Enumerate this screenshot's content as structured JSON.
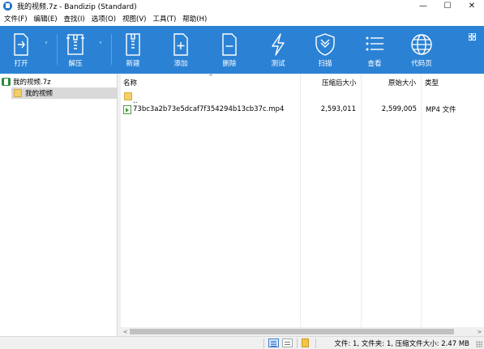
{
  "window": {
    "title": "我的视频.7z - Bandizip (Standard)",
    "minimize_glyph": "—",
    "maximize_glyph": "☐",
    "close_glyph": "✕"
  },
  "menu": [
    {
      "label": "文件(F)"
    },
    {
      "label": "编辑(E)"
    },
    {
      "label": "查找(I)"
    },
    {
      "label": "选项(O)"
    },
    {
      "label": "视图(V)"
    },
    {
      "label": "工具(T)"
    },
    {
      "label": "帮助(H)"
    }
  ],
  "toolbar": {
    "open": "打开",
    "extract": "解压",
    "new": "新建",
    "add": "添加",
    "delete": "删除",
    "test": "测试",
    "scan": "扫描",
    "view": "查看",
    "codepage": "代码页",
    "dropdown_glyph": "˅"
  },
  "tree": {
    "root": "我的视频.7z",
    "child": "我的视频"
  },
  "list": {
    "columns": {
      "name": "名称",
      "packed_size": "压缩后大小",
      "original_size": "原始大小",
      "type": "类型"
    },
    "sort_glyph": "^",
    "rows": [
      {
        "name": "..",
        "packed": "",
        "original": "",
        "type": ""
      },
      {
        "name": "73bc3a2b73e5dcaf7f354294b13cb37c.mp4",
        "packed": "2,593,011",
        "original": "2,599,005",
        "type": "MP4 文件"
      }
    ]
  },
  "scrollbar": {
    "left_glyph": "<",
    "right_glyph": ">"
  },
  "status": {
    "text": "文件: 1, 文件夹: 1, 压缩文件大小: 2.47 MB"
  },
  "colors": {
    "toolbar_bg": "#2b82d5",
    "selection_bg": "#d9d9d9"
  }
}
